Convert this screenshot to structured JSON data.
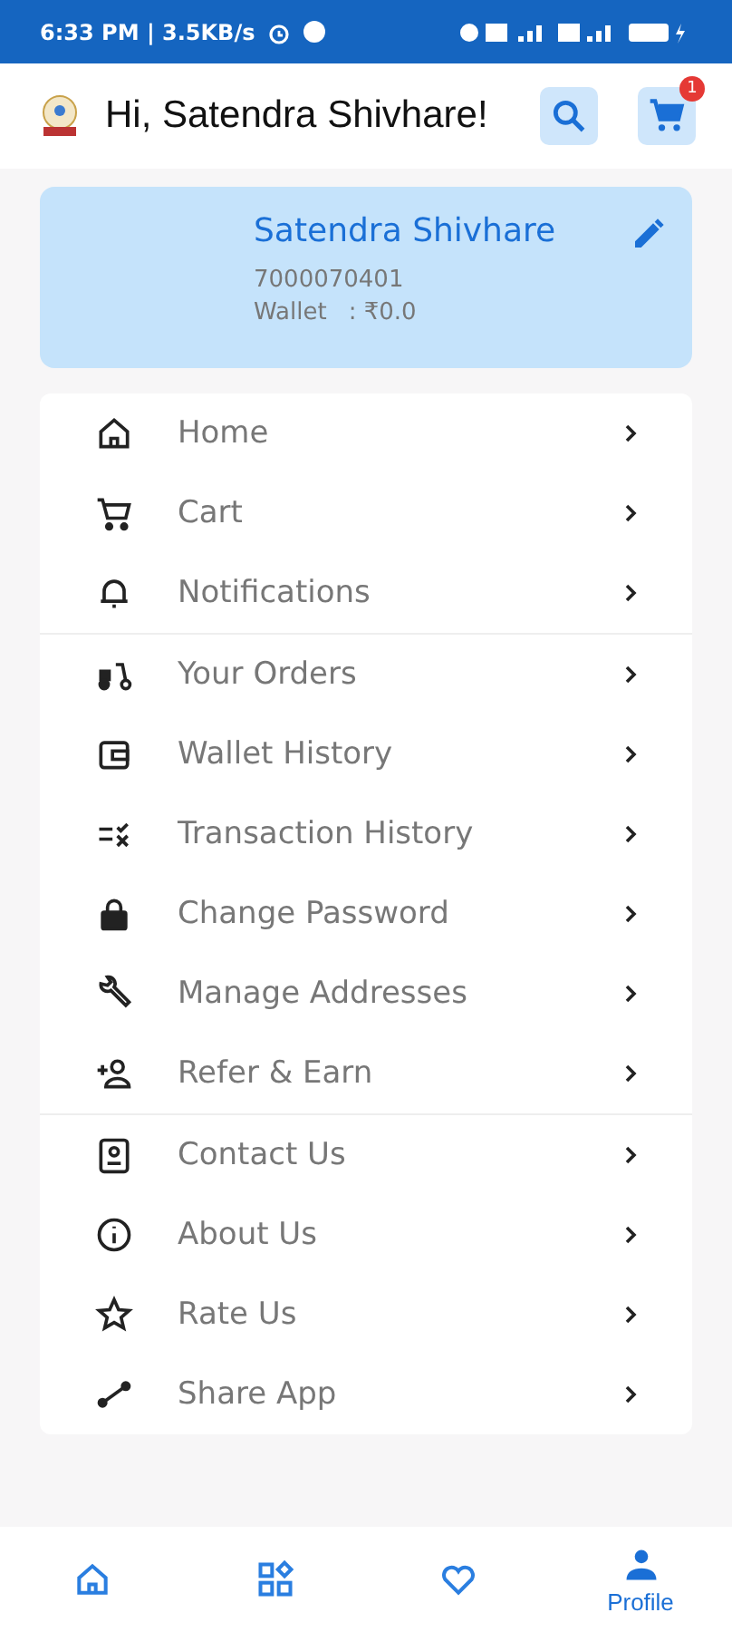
{
  "status_bar": {
    "time": "6:33 PM | 3.5KB/s"
  },
  "header": {
    "greeting": "Hi, Satendra Shivhare!",
    "cart_badge": "1"
  },
  "profile": {
    "name": "Satendra Shivhare",
    "phone": "7000070401",
    "wallet_label": "Wallet",
    "wallet_value": ": ₹0.0"
  },
  "menu_sections": [
    {
      "items": [
        {
          "label": "Home"
        },
        {
          "label": "Cart"
        },
        {
          "label": "Notifications"
        }
      ]
    },
    {
      "items": [
        {
          "label": "Your Orders"
        },
        {
          "label": "Wallet History"
        },
        {
          "label": "Transaction History"
        },
        {
          "label": "Change Password"
        },
        {
          "label": "Manage Addresses"
        },
        {
          "label": "Refer & Earn"
        }
      ]
    },
    {
      "items": [
        {
          "label": "Contact Us"
        },
        {
          "label": "About Us"
        },
        {
          "label": "Rate Us"
        },
        {
          "label": "Share App"
        }
      ]
    }
  ],
  "bottom_nav": [
    {
      "selected": false
    },
    {
      "selected": false
    },
    {
      "selected": false
    },
    {
      "selected": true,
      "label": "Profile"
    }
  ]
}
